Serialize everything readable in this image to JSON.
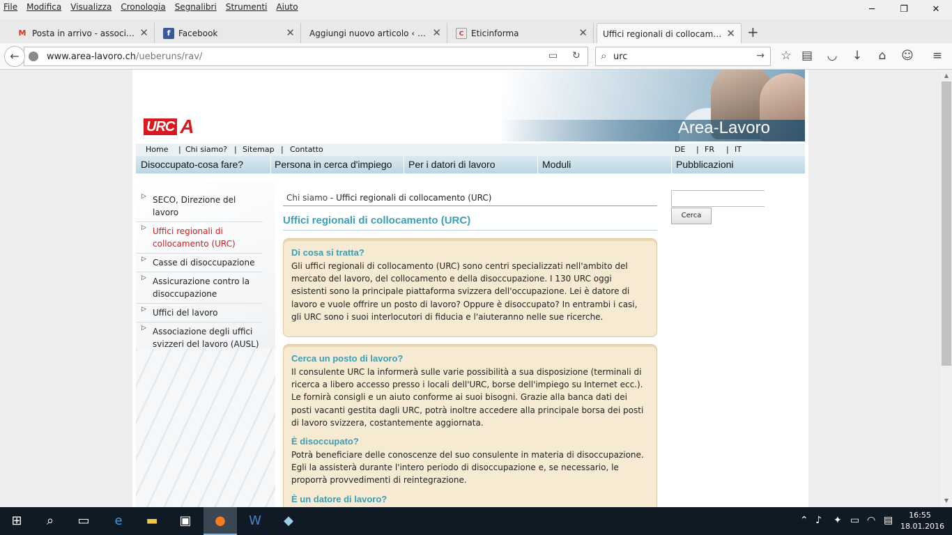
{
  "menubar": {
    "items": [
      "File",
      "Modifica",
      "Visualizza",
      "Cronologia",
      "Segnalibri",
      "Strumenti",
      "Aiuto"
    ]
  },
  "window_controls": {
    "minimize": "─",
    "maximize": "❐",
    "close": "✕"
  },
  "tabs": [
    {
      "title": "Posta in arrivo - associazio...",
      "icon": "gmail-icon",
      "active": false
    },
    {
      "title": "Facebook",
      "icon": "facebook-icon",
      "active": false
    },
    {
      "title": "Aggiungi nuovo articolo ‹ Etici...",
      "icon": "wordpress-icon",
      "active": false
    },
    {
      "title": "Eticinforma",
      "icon": "eticinforma-icon",
      "active": false
    },
    {
      "title": "Uffici regionali di collocament...",
      "icon": "",
      "active": true
    }
  ],
  "urlbar": {
    "host": "www.area-lavoro.ch",
    "path": "/ueberuns/rav/"
  },
  "searchbar": {
    "value": "urc"
  },
  "site": {
    "logo": {
      "text": "URC",
      "mark": "A"
    },
    "banner_title": "Area-Lavoro",
    "toplinks": [
      "Home",
      "Chi siamo?",
      "Sitemap",
      "Contatto"
    ],
    "languages": [
      "DE",
      "FR",
      "IT"
    ],
    "mainnav": [
      "Disoccupato-cosa fare?",
      "Persona in cerca d'impiego",
      "Per i datori di lavoro",
      "Moduli",
      "Pubblicazioni"
    ],
    "sidebar": [
      {
        "label": "SECO, Direzione del lavoro",
        "selected": false
      },
      {
        "label": "Uffici regionali di collocamento (URC)",
        "selected": true
      },
      {
        "label": "Casse di disoccupazione",
        "selected": false
      },
      {
        "label": "Assicurazione contro la disoccupazione",
        "selected": false
      },
      {
        "label": "Uffici del lavoro",
        "selected": false
      },
      {
        "label": "Associazione degli uffici svizzeri del lavoro (AUSL)",
        "selected": false
      }
    ],
    "breadcrumb": {
      "parent": "Chi siamo",
      "current": " - Uffici regionali di collocamento (URC)"
    },
    "page_title": "Uffici regionali di collocamento (URC)",
    "boxes": [
      {
        "sections": [
          {
            "heading": "Di cosa si tratta?",
            "text": "Gli uffici regionali di collocamento (URC) sono centri specializzati nell'ambito del mercato del lavoro, del collocamento e della disoccupazione. I 130 URC oggi esistenti sono la principale piattaforma svizzera dell'occupazione. Lei è datore di lavoro e vuole offrire un posto di lavoro? Oppure è disoccupato? In entrambi i casi, gli URC sono i suoi interlocutori di fiducia e l'aiuteranno nelle sue ricerche."
          }
        ]
      },
      {
        "sections": [
          {
            "heading": "Cerca un posto di lavoro?",
            "text": "Il consulente URC la informerà sulle varie possibilità a sua disposizione (terminali di ricerca a libero accesso presso i locali dell'URC, borse dell'impiego su Internet ecc.). Le fornirà consigli e un aiuto conforme ai suoi bisogni. Grazie alla banca dati dei posti vacanti gestita dagli URC, potrà inoltre accedere alla principale borsa dei posti di lavoro svizzera, costantemente aggiornata."
          },
          {
            "heading": "È disoccupato?",
            "text": "Potrà beneficiare delle conoscenze del suo consulente in materia di disoccupazione. Egli la assisterà durante l'intero periodo di disoccupazione e, se necessario, le proporrà provvedimenti di reintegrazione."
          },
          {
            "heading": "È un datore di lavoro?",
            "text": ""
          }
        ]
      }
    ],
    "search_button": "Cerca"
  },
  "taskbar": {
    "time": "16:55",
    "date": "18.01.2016"
  }
}
